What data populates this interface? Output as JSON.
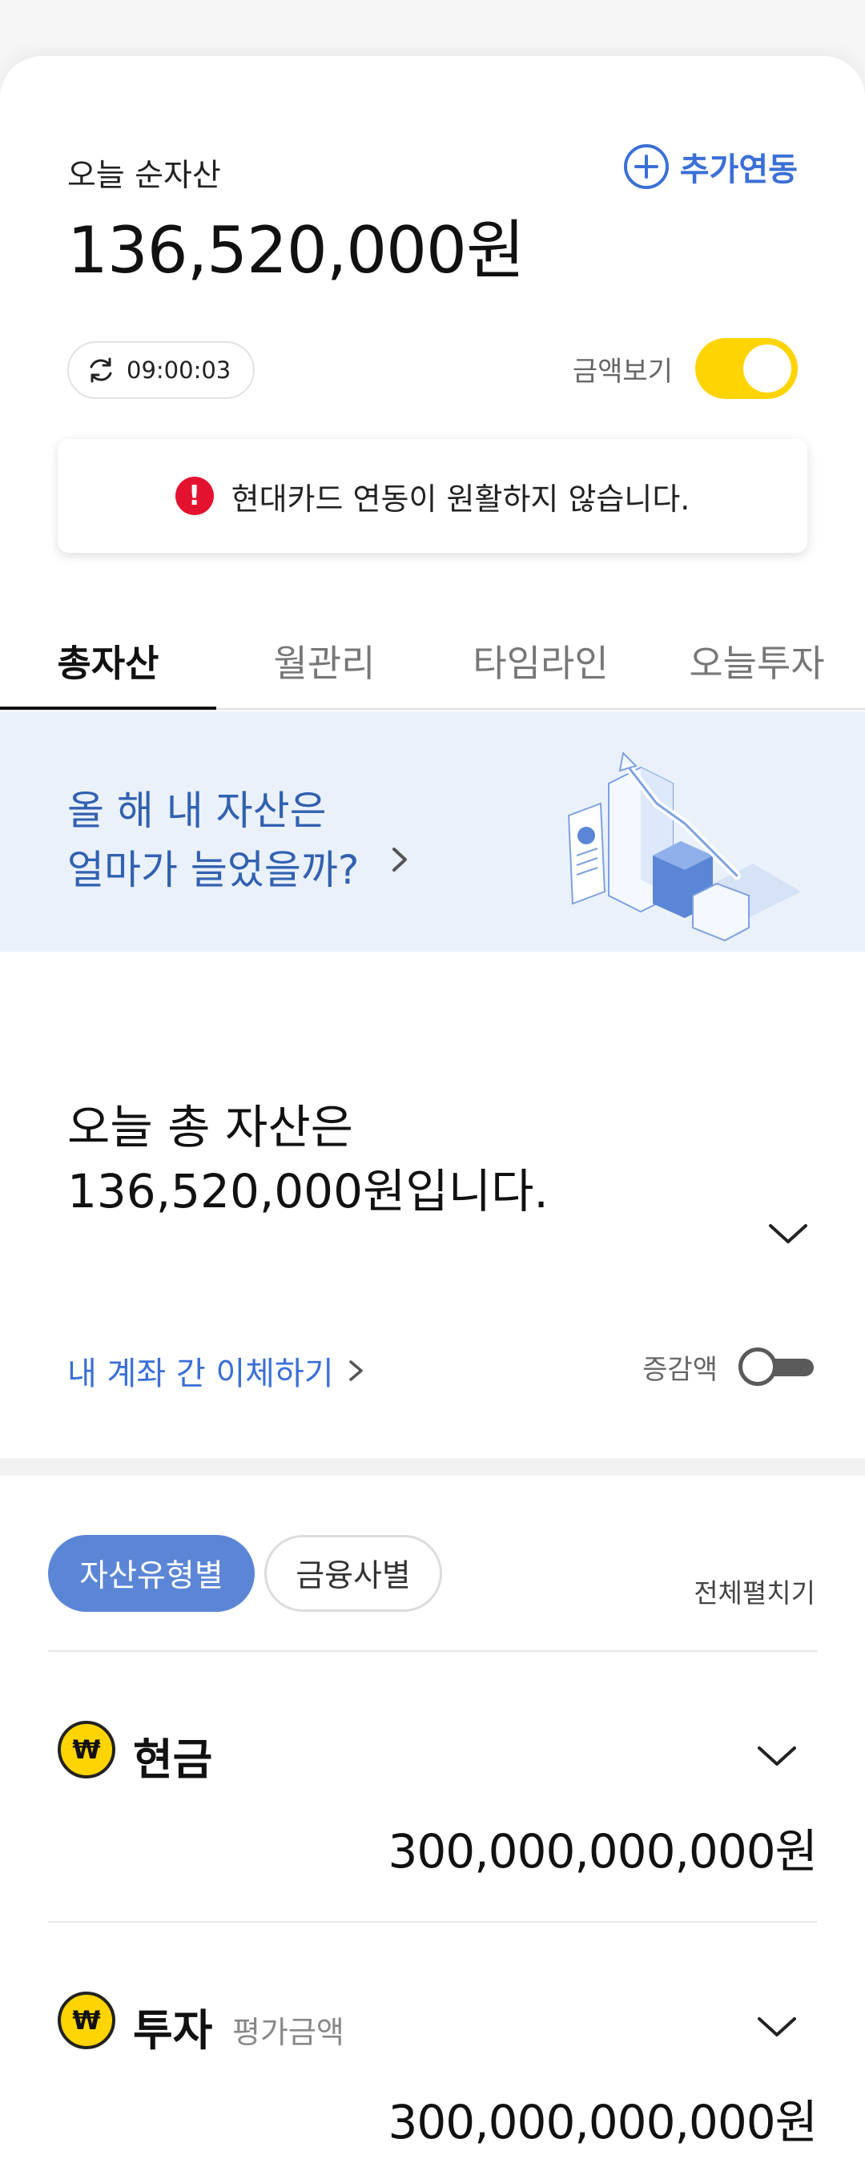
{
  "header": {
    "net_label": "오늘 순자산",
    "net_value": "136,520,000원",
    "add_link": "추가연동",
    "sync_time": "09:00:03",
    "amount_view_label": "금액보기",
    "amount_view_on": true
  },
  "alert": {
    "message": "현대카드 연동이 원활하지 않습니다.",
    "icon": "!"
  },
  "tabs": [
    {
      "label": "총자산",
      "active": true
    },
    {
      "label": "월관리",
      "active": false
    },
    {
      "label": "타임라인",
      "active": false
    },
    {
      "label": "오늘투자",
      "active": false
    }
  ],
  "banner": {
    "line1": "올 해 내 자산은",
    "line2": "얼마가 늘었을까?"
  },
  "total": {
    "line1": "오늘 총 자산은",
    "line2": "136,520,000원입니다.",
    "transfer_link": "내 계좌 간 이체하기",
    "delta_label": "증감액",
    "delta_on": false
  },
  "filter": {
    "chips": [
      "자산유형별",
      "금융사별"
    ],
    "expand_all": "전체펼치기"
  },
  "assets": [
    {
      "name": "현금",
      "sub": "",
      "amount": "300,000,000,000원",
      "icon": "₩"
    },
    {
      "name": "투자",
      "sub": "평가금액",
      "amount": "300,000,000,000원",
      "icon": "₩"
    }
  ],
  "colors": {
    "accent_blue": "#3a6fd6",
    "toggle_yellow": "#ffd400",
    "chip_blue": "#5b86d6",
    "banner_bg": "#ebf1fb",
    "error_red": "#e3132f"
  }
}
